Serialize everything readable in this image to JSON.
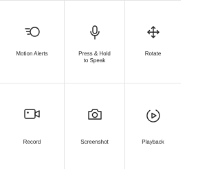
{
  "controls": [
    {
      "id": "motion-alerts",
      "icon": "motion-alerts-icon",
      "label_lines": [
        "Motion Alerts"
      ]
    },
    {
      "id": "press-hold-to-speak",
      "icon": "microphone-icon",
      "label_lines": [
        "Press & Hold",
        "to Speak"
      ]
    },
    {
      "id": "rotate",
      "icon": "move-arrows-icon",
      "label_lines": [
        "Rotate"
      ]
    },
    {
      "id": "record",
      "icon": "video-camera-icon",
      "label_lines": [
        "Record"
      ]
    },
    {
      "id": "screenshot",
      "icon": "camera-icon",
      "label_lines": [
        "Screenshot"
      ]
    },
    {
      "id": "playback",
      "icon": "play-circle-icon",
      "label_lines": [
        "Playback"
      ]
    }
  ],
  "colors": {
    "icon": "#222222",
    "divider": "#e4e4e4",
    "background": "#ffffff"
  }
}
